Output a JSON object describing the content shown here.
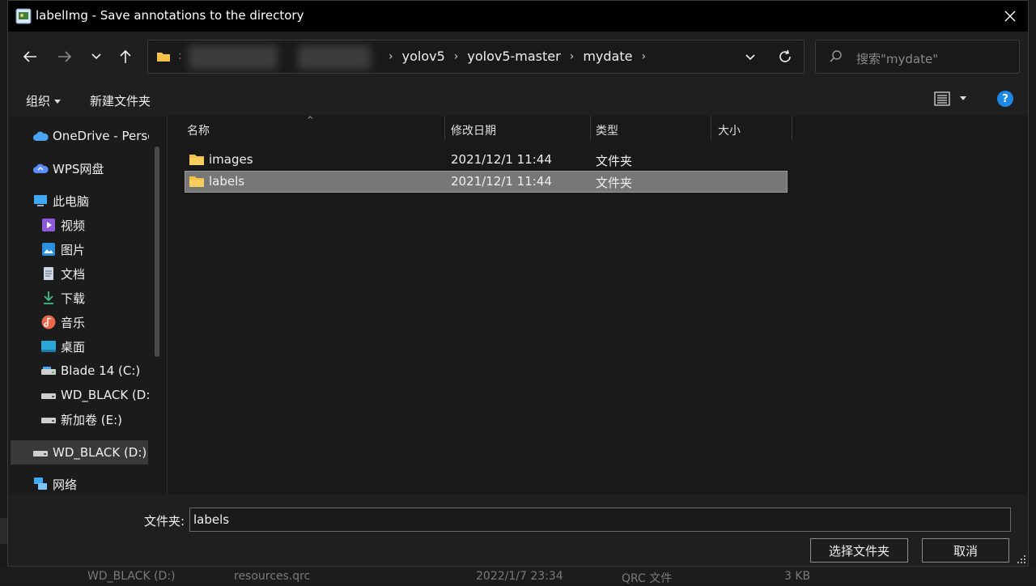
{
  "window": {
    "title": "labelImg - Save annotations to the directory"
  },
  "address": {
    "crumbs": [
      "yolov5",
      "yolov5-master",
      "mydate"
    ]
  },
  "search": {
    "placeholder": "搜索\"mydate\""
  },
  "toolbar": {
    "organize": "组织",
    "new_folder": "新建文件夹"
  },
  "sidebar": {
    "items": [
      {
        "label": "OneDrive - Perso",
        "icon": "cloud-icon"
      },
      {
        "label": "WPS网盘",
        "icon": "wps-cloud-icon"
      },
      {
        "label": "此电脑",
        "icon": "computer-icon"
      },
      {
        "label": "视频",
        "icon": "video-icon"
      },
      {
        "label": "图片",
        "icon": "picture-icon"
      },
      {
        "label": "文档",
        "icon": "document-icon"
      },
      {
        "label": "下载",
        "icon": "download-icon"
      },
      {
        "label": "音乐",
        "icon": "music-icon"
      },
      {
        "label": "桌面",
        "icon": "desktop-icon"
      },
      {
        "label": "Blade 14 (C:)",
        "icon": "drive-icon"
      },
      {
        "label": "WD_BLACK (D:)",
        "icon": "drive-icon"
      },
      {
        "label": "新加卷 (E:)",
        "icon": "drive-icon"
      },
      {
        "label": "WD_BLACK (D:)",
        "icon": "drive-icon"
      },
      {
        "label": "网络",
        "icon": "network-icon"
      }
    ]
  },
  "columns": {
    "name": "名称",
    "modified": "修改日期",
    "type": "类型",
    "size": "大小"
  },
  "files": [
    {
      "name": "images",
      "modified": "2021/12/1 11:44",
      "type": "文件夹",
      "size": ""
    },
    {
      "name": "labels",
      "modified": "2021/12/1 11:44",
      "type": "文件夹",
      "size": ""
    }
  ],
  "footer": {
    "folder_label": "文件夹:",
    "folder_value": "labels",
    "select_button": "选择文件夹",
    "cancel_button": "取消"
  },
  "background_window": {
    "drive": "WD_BLACK (D:)",
    "file": "resources.qrc",
    "date": "2022/1/7 23:34",
    "type": "QRC 文件",
    "size": "3 KB"
  },
  "colors": {
    "accent": "#1e88e5",
    "folder": "#f5c04a",
    "selection": "#777777"
  }
}
